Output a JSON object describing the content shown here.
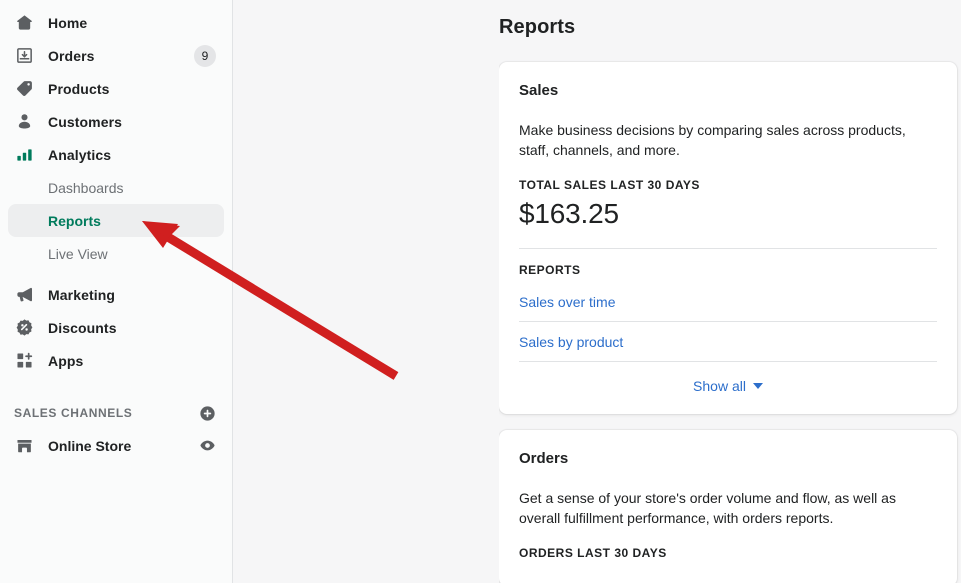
{
  "sidebar": {
    "items": [
      {
        "label": "Home",
        "icon": "home-icon",
        "badge": null
      },
      {
        "label": "Orders",
        "icon": "orders-inbox-icon",
        "badge": "9"
      },
      {
        "label": "Products",
        "icon": "product-tag-icon",
        "badge": null
      },
      {
        "label": "Customers",
        "icon": "customer-person-icon",
        "badge": null
      },
      {
        "label": "Analytics",
        "icon": "analytics-bars-icon",
        "badge": null
      }
    ],
    "analytics_subitems": [
      {
        "label": "Dashboards",
        "active": false
      },
      {
        "label": "Reports",
        "active": true
      },
      {
        "label": "Live View",
        "active": false
      }
    ],
    "items_lower": [
      {
        "label": "Marketing",
        "icon": "megaphone-icon"
      },
      {
        "label": "Discounts",
        "icon": "discount-badge-icon"
      },
      {
        "label": "Apps",
        "icon": "apps-grid-plus-icon"
      }
    ],
    "sales_channels": {
      "heading": "SALES CHANNELS",
      "add_icon": "plus-circle-icon",
      "channels": [
        {
          "label": "Online Store",
          "icon": "storefront-icon",
          "action_icon": "eye-view-icon"
        }
      ]
    }
  },
  "main": {
    "page_title": "Reports",
    "cards": [
      {
        "title": "Sales",
        "description": "Make business decisions by comparing sales across products, staff, channels, and more.",
        "stat_label": "TOTAL SALES LAST 30 DAYS",
        "stat_value": "$163.25",
        "reports_label": "REPORTS",
        "reports": [
          "Sales over time",
          "Sales by product"
        ],
        "show_all": "Show all"
      },
      {
        "title": "Orders",
        "description": "Get a sense of your store's order volume and flow, as well as overall fulfillment performance, with orders reports.",
        "stat_label": "ORDERS LAST 30 DAYS"
      }
    ]
  },
  "annotation": {
    "arrow_color": "#d01f1f",
    "arrow_name": "red-pointer-arrow"
  },
  "colors": {
    "accent_green": "#007b5c",
    "link_blue": "#2c6ecb",
    "text": "#202223",
    "muted": "#6d7175",
    "surface": "#ffffff",
    "background": "#f6f6f7"
  }
}
